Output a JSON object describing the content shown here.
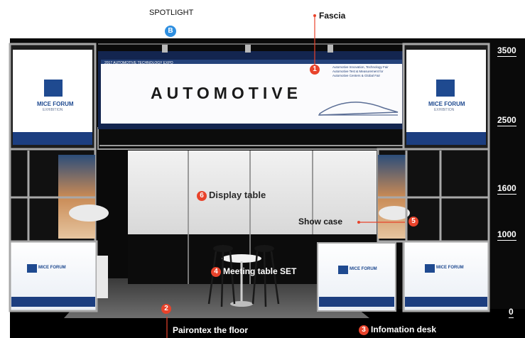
{
  "callouts": {
    "spotlight": {
      "letter": "B",
      "text": "SPOTLIGHT"
    },
    "fascia": {
      "text": "Fascia"
    },
    "fascia_marker": {
      "num": "1"
    },
    "display_table": {
      "num": "6",
      "text": "Display table"
    },
    "show_case": {
      "num": "5",
      "text": "Show case"
    },
    "meeting_table": {
      "num": "4",
      "text": "Meeting table SET"
    },
    "floor": {
      "num": "2",
      "text": "Pairontex the floor"
    },
    "info_desk": {
      "num": "3",
      "text": "Infomation desk"
    }
  },
  "fascia": {
    "header_small": "2017 AUTOMOTIVE TECHNOLOGY EXPO",
    "title": "AUTOMOTIVE",
    "right_text": [
      "Automotive Innovation, Technology Fair",
      "Automotive Test & Measurement for",
      "Automotive Centers & Global Fair"
    ]
  },
  "brand": {
    "name": "MICE FORUM",
    "sub": "EXHIBITION"
  },
  "scale_marks": [
    "3500",
    "2500",
    "1600",
    "1000",
    "0"
  ],
  "colors": {
    "accent_red": "#e8432b",
    "accent_blue": "#2f8fe0",
    "navy": "#13254f"
  }
}
